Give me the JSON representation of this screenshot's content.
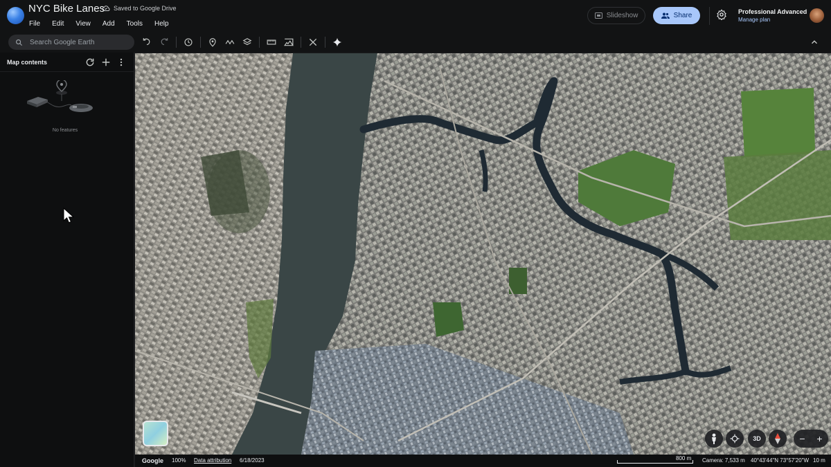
{
  "app": {
    "title": "NYC Bike Lanes",
    "saved_status": "Saved to Google Drive",
    "menu": [
      "File",
      "Edit",
      "View",
      "Add",
      "Tools",
      "Help"
    ]
  },
  "header": {
    "slideshow_label": "Slideshow",
    "share_label": "Share",
    "plan_title": "Professional Advanced",
    "plan_link": "Manage plan"
  },
  "toolbar": {
    "search_placeholder": "Search Google Earth",
    "icons": [
      "undo-icon",
      "redo-icon",
      "history-icon",
      "placemark-icon",
      "path-icon",
      "layers-icon",
      "measure-icon",
      "image-overlay-icon",
      "satellite-icon",
      "sparkle-icon"
    ]
  },
  "sidebar": {
    "title": "Map contents",
    "empty_text": "No features"
  },
  "map": {
    "view_3d_label": "3D"
  },
  "status": {
    "brand": "Google",
    "zoom": "100%",
    "data_attribution": "Data attribution",
    "date": "6/18/2023",
    "scale_label": "800 m",
    "camera": "Camera: 7,533 m",
    "coords": "40°43'44\"N 73°57'20\"W",
    "elevation": "10 m"
  },
  "colors": {
    "accent": "#a8c7fa",
    "header_bg": "#121314",
    "sidebar_bg": "#0e0f10",
    "river": "#2f3d3e",
    "creek": "#1f2a33"
  }
}
